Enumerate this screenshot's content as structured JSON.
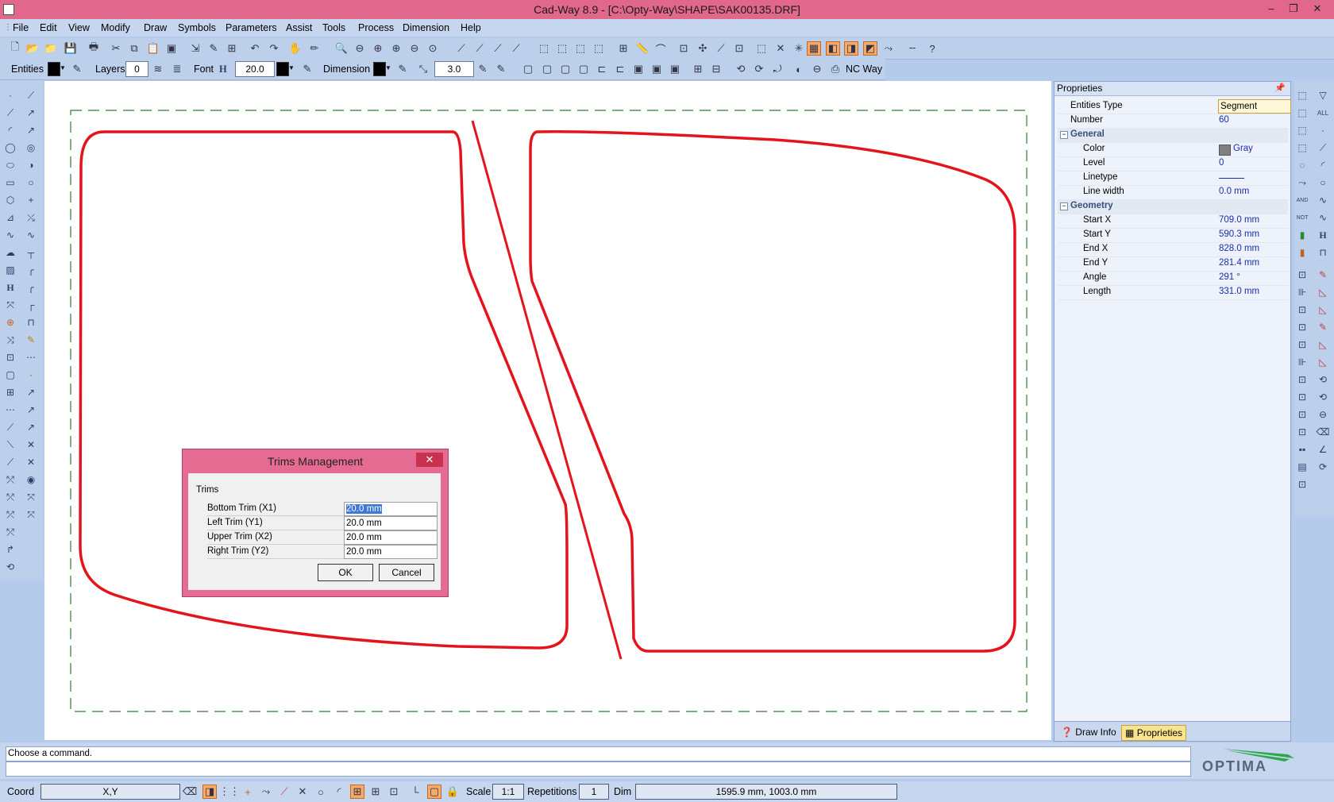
{
  "window": {
    "title": "Cad-Way 8.9 - [C:\\Opty-Way\\SHAPE\\SAK00135.DRF]",
    "controls": [
      "–",
      "❐",
      "✕"
    ]
  },
  "menu": [
    "File",
    "Edit",
    "View",
    "Modify",
    "Draw",
    "Symbols",
    "Parameters",
    "Assist",
    "Tools",
    "Process",
    "Dimension",
    "Help"
  ],
  "toolbar2": {
    "entities_label": "Entities",
    "layers_label": "Layers",
    "layers_value": "0",
    "font_label": "Font",
    "font_h_glyph": "H",
    "font_value": "20.0",
    "dimension_label": "Dimension",
    "dimension_value": "3.0",
    "ncway_label": "NC Way"
  },
  "properties": {
    "panel_title": "Proprieties",
    "rows": [
      {
        "label": "Entities Type",
        "value": "Segment"
      },
      {
        "label": "Number",
        "value": "60"
      }
    ],
    "general": {
      "title": "General",
      "rows": [
        {
          "label": "Color",
          "value": "Gray"
        },
        {
          "label": "Level",
          "value": "0"
        },
        {
          "label": "Linetype",
          "value": ""
        },
        {
          "label": "Line width",
          "value": "0.0 mm"
        }
      ]
    },
    "geometry": {
      "title": "Geometry",
      "rows": [
        {
          "label": "Start X",
          "value": "709.0 mm"
        },
        {
          "label": "Start Y",
          "value": "590.3 mm"
        },
        {
          "label": "End X",
          "value": "828.0 mm"
        },
        {
          "label": "End Y",
          "value": "281.4 mm"
        },
        {
          "label": "Angle",
          "value": "291 °"
        },
        {
          "label": "Length",
          "value": "331.0 mm"
        }
      ]
    },
    "tabs": [
      "Draw Info",
      "Proprieties"
    ]
  },
  "dialog": {
    "title": "Trims Management",
    "close": "✕",
    "group": "Trims",
    "rows": [
      {
        "label": "Bottom Trim (X1)",
        "value": "20.0 mm"
      },
      {
        "label": "Left Trim (Y1)",
        "value": "20.0 mm"
      },
      {
        "label": "Upper Trim (X2)",
        "value": "20.0 mm"
      },
      {
        "label": "Right Trim (Y2)",
        "value": "20.0 mm"
      }
    ],
    "ok": "OK",
    "cancel": "Cancel"
  },
  "command": {
    "prompt": "Choose a command.",
    "input": ""
  },
  "logo": "OPTIMA",
  "status": {
    "coord_label": "Coord",
    "coord_value": "X,Y",
    "scale_label": "Scale",
    "scale_value": "1:1",
    "repetitions_label": "Repetitions",
    "repetitions_value": "1",
    "dim_label": "Dim",
    "dim_value": "1595.9 mm, 1003.0 mm"
  },
  "colors": {
    "title_bar": "#e1678d",
    "shape_stroke": "#e4141c",
    "trim_frame": "#2e7d32",
    "dialog_frame": "#e66b92"
  }
}
